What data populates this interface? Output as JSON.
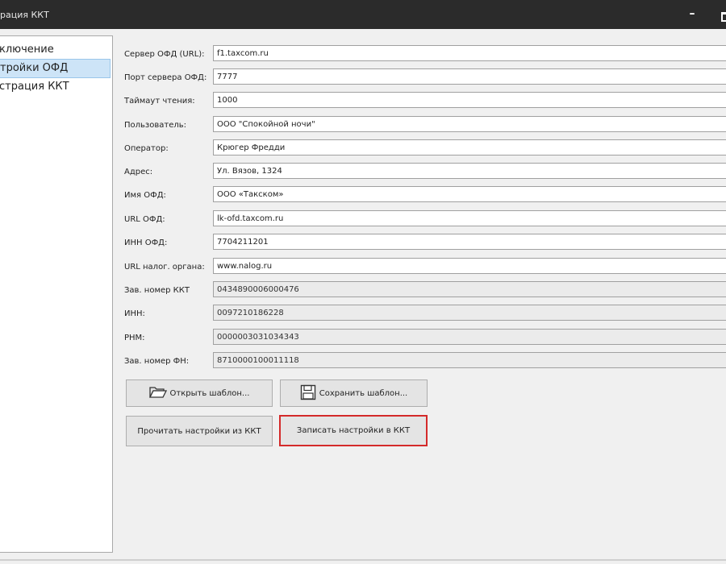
{
  "window": {
    "title": "рация ККТ",
    "minimize_glyph": "–"
  },
  "sidebar": {
    "items": [
      {
        "label": "ключение"
      },
      {
        "label": "тройки ОФД"
      },
      {
        "label": "страция ККТ"
      }
    ]
  },
  "form": {
    "fields": [
      {
        "label": "Сервер ОФД (URL):",
        "value": "f1.taxcom.ru"
      },
      {
        "label": "Порт сервера ОФД:",
        "value": "7777"
      },
      {
        "label": "Таймаут чтения:",
        "value": "1000"
      },
      {
        "label": "Пользователь:",
        "value": "ООО \"Спокойной ночи\""
      },
      {
        "label": "Оператор:",
        "value": "Крюгер Фредди"
      },
      {
        "label": "Адрес:",
        "value": "Ул. Вязов, 1324"
      },
      {
        "label": "Имя ОФД:",
        "value": "ООО «Такском»"
      },
      {
        "label": "URL ОФД:",
        "value": "lk-ofd.taxcom.ru"
      },
      {
        "label": "ИНН ОФД:",
        "value": "7704211201"
      },
      {
        "label": "URL налог. органа:",
        "value": "www.nalog.ru"
      },
      {
        "label": "Зав. номер ККТ",
        "value": "0434890006000476"
      },
      {
        "label": "ИНН:",
        "value": "0097210186228"
      },
      {
        "label": "РНМ:",
        "value": "0000003031034343"
      },
      {
        "label": "Зав. номер ФН:",
        "value": "8710000100011118"
      }
    ]
  },
  "buttons": {
    "open_template": "Открыть шаблон...",
    "save_template": "Сохранить шаблон...",
    "read_settings": "Прочитать настройки из ККТ",
    "write_settings": "Записать настройки  в ККТ"
  }
}
